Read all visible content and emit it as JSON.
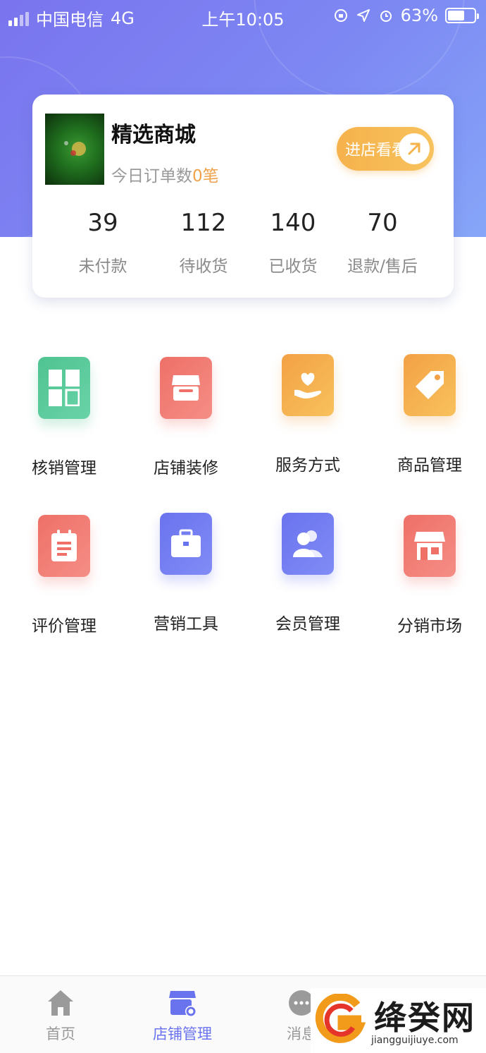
{
  "status_bar": {
    "carrier": "中国电信",
    "network": "4G",
    "time": "上午10:05",
    "battery": "63%",
    "battery_level": 0.63
  },
  "shop": {
    "name": "精选商城",
    "orders_prefix": "今日订单数",
    "orders_count": "0",
    "orders_suffix": "笔",
    "enter_label": "进店看看"
  },
  "stats": [
    {
      "value": "39",
      "label": "未付款"
    },
    {
      "value": "112",
      "label": "待收货"
    },
    {
      "value": "140",
      "label": "已收货"
    },
    {
      "value": "70",
      "label": "退款/售后"
    }
  ],
  "menu": [
    {
      "label": "核销管理",
      "icon": "grid-icon",
      "color": "green"
    },
    {
      "label": "店铺装修",
      "icon": "storefront-icon",
      "color": "red"
    },
    {
      "label": "服务方式",
      "icon": "heart-hand-icon",
      "color": "orange"
    },
    {
      "label": "商品管理",
      "icon": "tag-icon",
      "color": "orange"
    },
    {
      "label": "评价管理",
      "icon": "notepad-icon",
      "color": "red"
    },
    {
      "label": "营销工具",
      "icon": "briefcase-icon",
      "color": "blue"
    },
    {
      "label": "会员管理",
      "icon": "users-icon",
      "color": "blue"
    },
    {
      "label": "分销市场",
      "icon": "market-stall-icon",
      "color": "red"
    }
  ],
  "tabs": [
    {
      "label": "首页",
      "icon": "home-icon",
      "active": false
    },
    {
      "label": "店铺管理",
      "icon": "shop-manage-icon",
      "active": true
    },
    {
      "label": "消息",
      "icon": "message-icon",
      "active": false
    }
  ],
  "watermark": {
    "title": "绛癸网",
    "url": "jiangguijiuye.com"
  },
  "colors": {
    "accent": "#6a73ee",
    "orange": "#f6b24c",
    "green": "#4fc391",
    "red": "#ee7067"
  }
}
